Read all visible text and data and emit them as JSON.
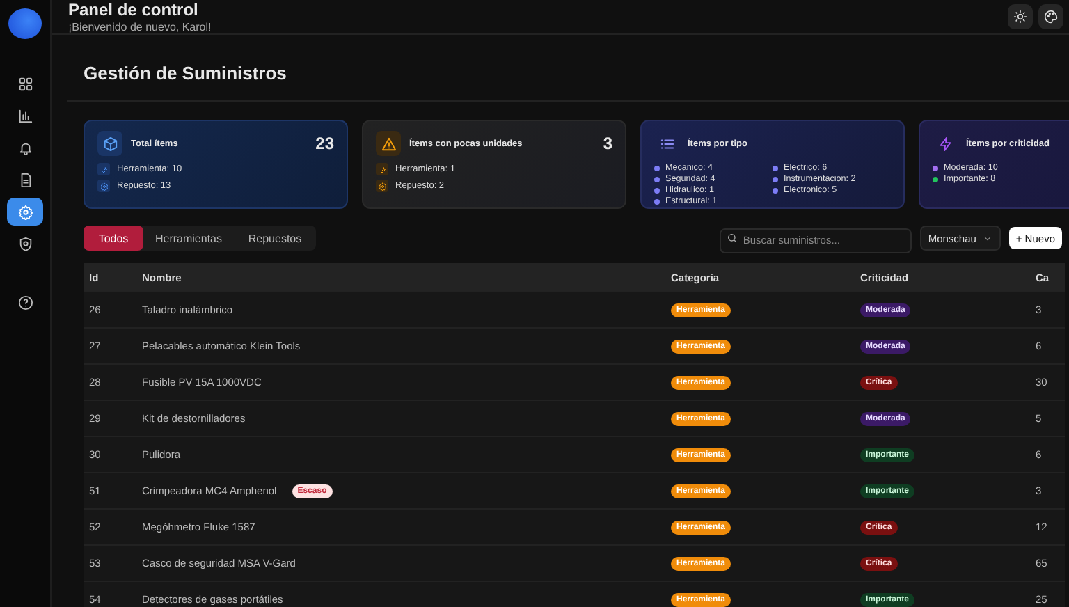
{
  "header": {
    "title": "Panel de control",
    "subtitle": "¡Bienvenido de nuevo, Karol!"
  },
  "sidebar": {
    "items": [
      {
        "selected": false
      },
      {
        "selected": false
      },
      {
        "selected": false
      },
      {
        "selected": false
      },
      {
        "selected": true
      },
      {
        "selected": false
      }
    ]
  },
  "page_title": "Gestión de Suministros",
  "cards": [
    {
      "kind": "total",
      "title": "Total ítems",
      "value": "23",
      "lines": [
        {
          "text": "Herramienta: 10"
        },
        {
          "text": "Repuesto: 13"
        }
      ]
    },
    {
      "kind": "low",
      "title": "Ítems con pocas unidades",
      "value": "3",
      "lines": [
        {
          "text": "Herramienta: 1"
        },
        {
          "text": "Repuesto: 2"
        }
      ]
    },
    {
      "kind": "types",
      "title": "Ítems por tipo",
      "columns": [
        [
          {
            "text": "Mecanico: 4",
            "color": "#7c7cf5"
          },
          {
            "text": "Seguridad: 4",
            "color": "#7c7cf5"
          },
          {
            "text": "Hidraulico: 1",
            "color": "#7c7cf5"
          },
          {
            "text": "Estructural: 1",
            "color": "#7c7cf5"
          }
        ],
        [
          {
            "text": "Electrico: 6",
            "color": "#7c7cf5"
          },
          {
            "text": "Instrumentacion: 2",
            "color": "#7c7cf5"
          },
          {
            "text": "Electronico: 5",
            "color": "#7c7cf5"
          }
        ]
      ]
    },
    {
      "kind": "criticality",
      "title": "Ítems por criticidad",
      "columns": [
        [
          {
            "text": "Moderada: 10",
            "color": "#a26ef0"
          },
          {
            "text": "Importante: 8",
            "color": "#22c55e"
          }
        ]
      ]
    }
  ],
  "tabs": [
    {
      "label": "Todos",
      "selected": true
    },
    {
      "label": "Herramientas",
      "selected": false
    },
    {
      "label": "Repuestos",
      "selected": false
    }
  ],
  "search": {
    "placeholder": "Buscar suministros..."
  },
  "location_select": {
    "value": "Monschau"
  },
  "new_button": "+ Nuevo",
  "table": {
    "columns": [
      "Id",
      "Nombre",
      "Categoria",
      "Criticidad",
      "Ca"
    ],
    "rows": [
      {
        "id": "26",
        "name": "Taladro inalámbrico",
        "category": {
          "text": "Herramienta",
          "kind": "tool"
        },
        "criticality": {
          "text": "Moderada",
          "kind": "moderate"
        },
        "column_5": "3"
      },
      {
        "id": "27",
        "name": "Pelacables automático Klein Tools",
        "category": {
          "text": "Herramienta",
          "kind": "tool"
        },
        "criticality": {
          "text": "Moderada",
          "kind": "moderate"
        },
        "column_5": "6"
      },
      {
        "id": "28",
        "name": "Fusible PV 15A 1000VDC",
        "category": {
          "text": "Herramienta",
          "kind": "tool"
        },
        "criticality": {
          "text": "Crítica",
          "kind": "critical"
        },
        "column_5": "30"
      },
      {
        "id": "29",
        "name": "Kit de destornilladores",
        "category": {
          "text": "Herramienta",
          "kind": "tool"
        },
        "criticality": {
          "text": "Moderada",
          "kind": "moderate"
        },
        "column_5": "5"
      },
      {
        "id": "30",
        "name": "Pulidora",
        "category": {
          "text": "Herramienta",
          "kind": "tool"
        },
        "criticality": {
          "text": "Importante",
          "kind": "important"
        },
        "column_5": "6"
      },
      {
        "id": "51",
        "name": "Crimpeadora MC4 Amphenol",
        "badge": "Escaso",
        "category": {
          "text": "Herramienta",
          "kind": "tool"
        },
        "criticality": {
          "text": "Importante",
          "kind": "important"
        },
        "column_5": "3"
      },
      {
        "id": "52",
        "name": "Megóhmetro Fluke 1587",
        "category": {
          "text": "Herramienta",
          "kind": "tool"
        },
        "criticality": {
          "text": "Crítica",
          "kind": "critical"
        },
        "column_5": "12"
      },
      {
        "id": "53",
        "name": "Casco de seguridad MSA V-Gard",
        "category": {
          "text": "Herramienta",
          "kind": "tool"
        },
        "criticality": {
          "text": "Crítica",
          "kind": "critical"
        },
        "column_5": "65"
      },
      {
        "id": "54",
        "name": "Detectores de gases portátiles",
        "category": {
          "text": "Herramienta",
          "kind": "tool"
        },
        "criticality": {
          "text": "Importante",
          "kind": "important"
        },
        "column_5": "25"
      }
    ]
  }
}
